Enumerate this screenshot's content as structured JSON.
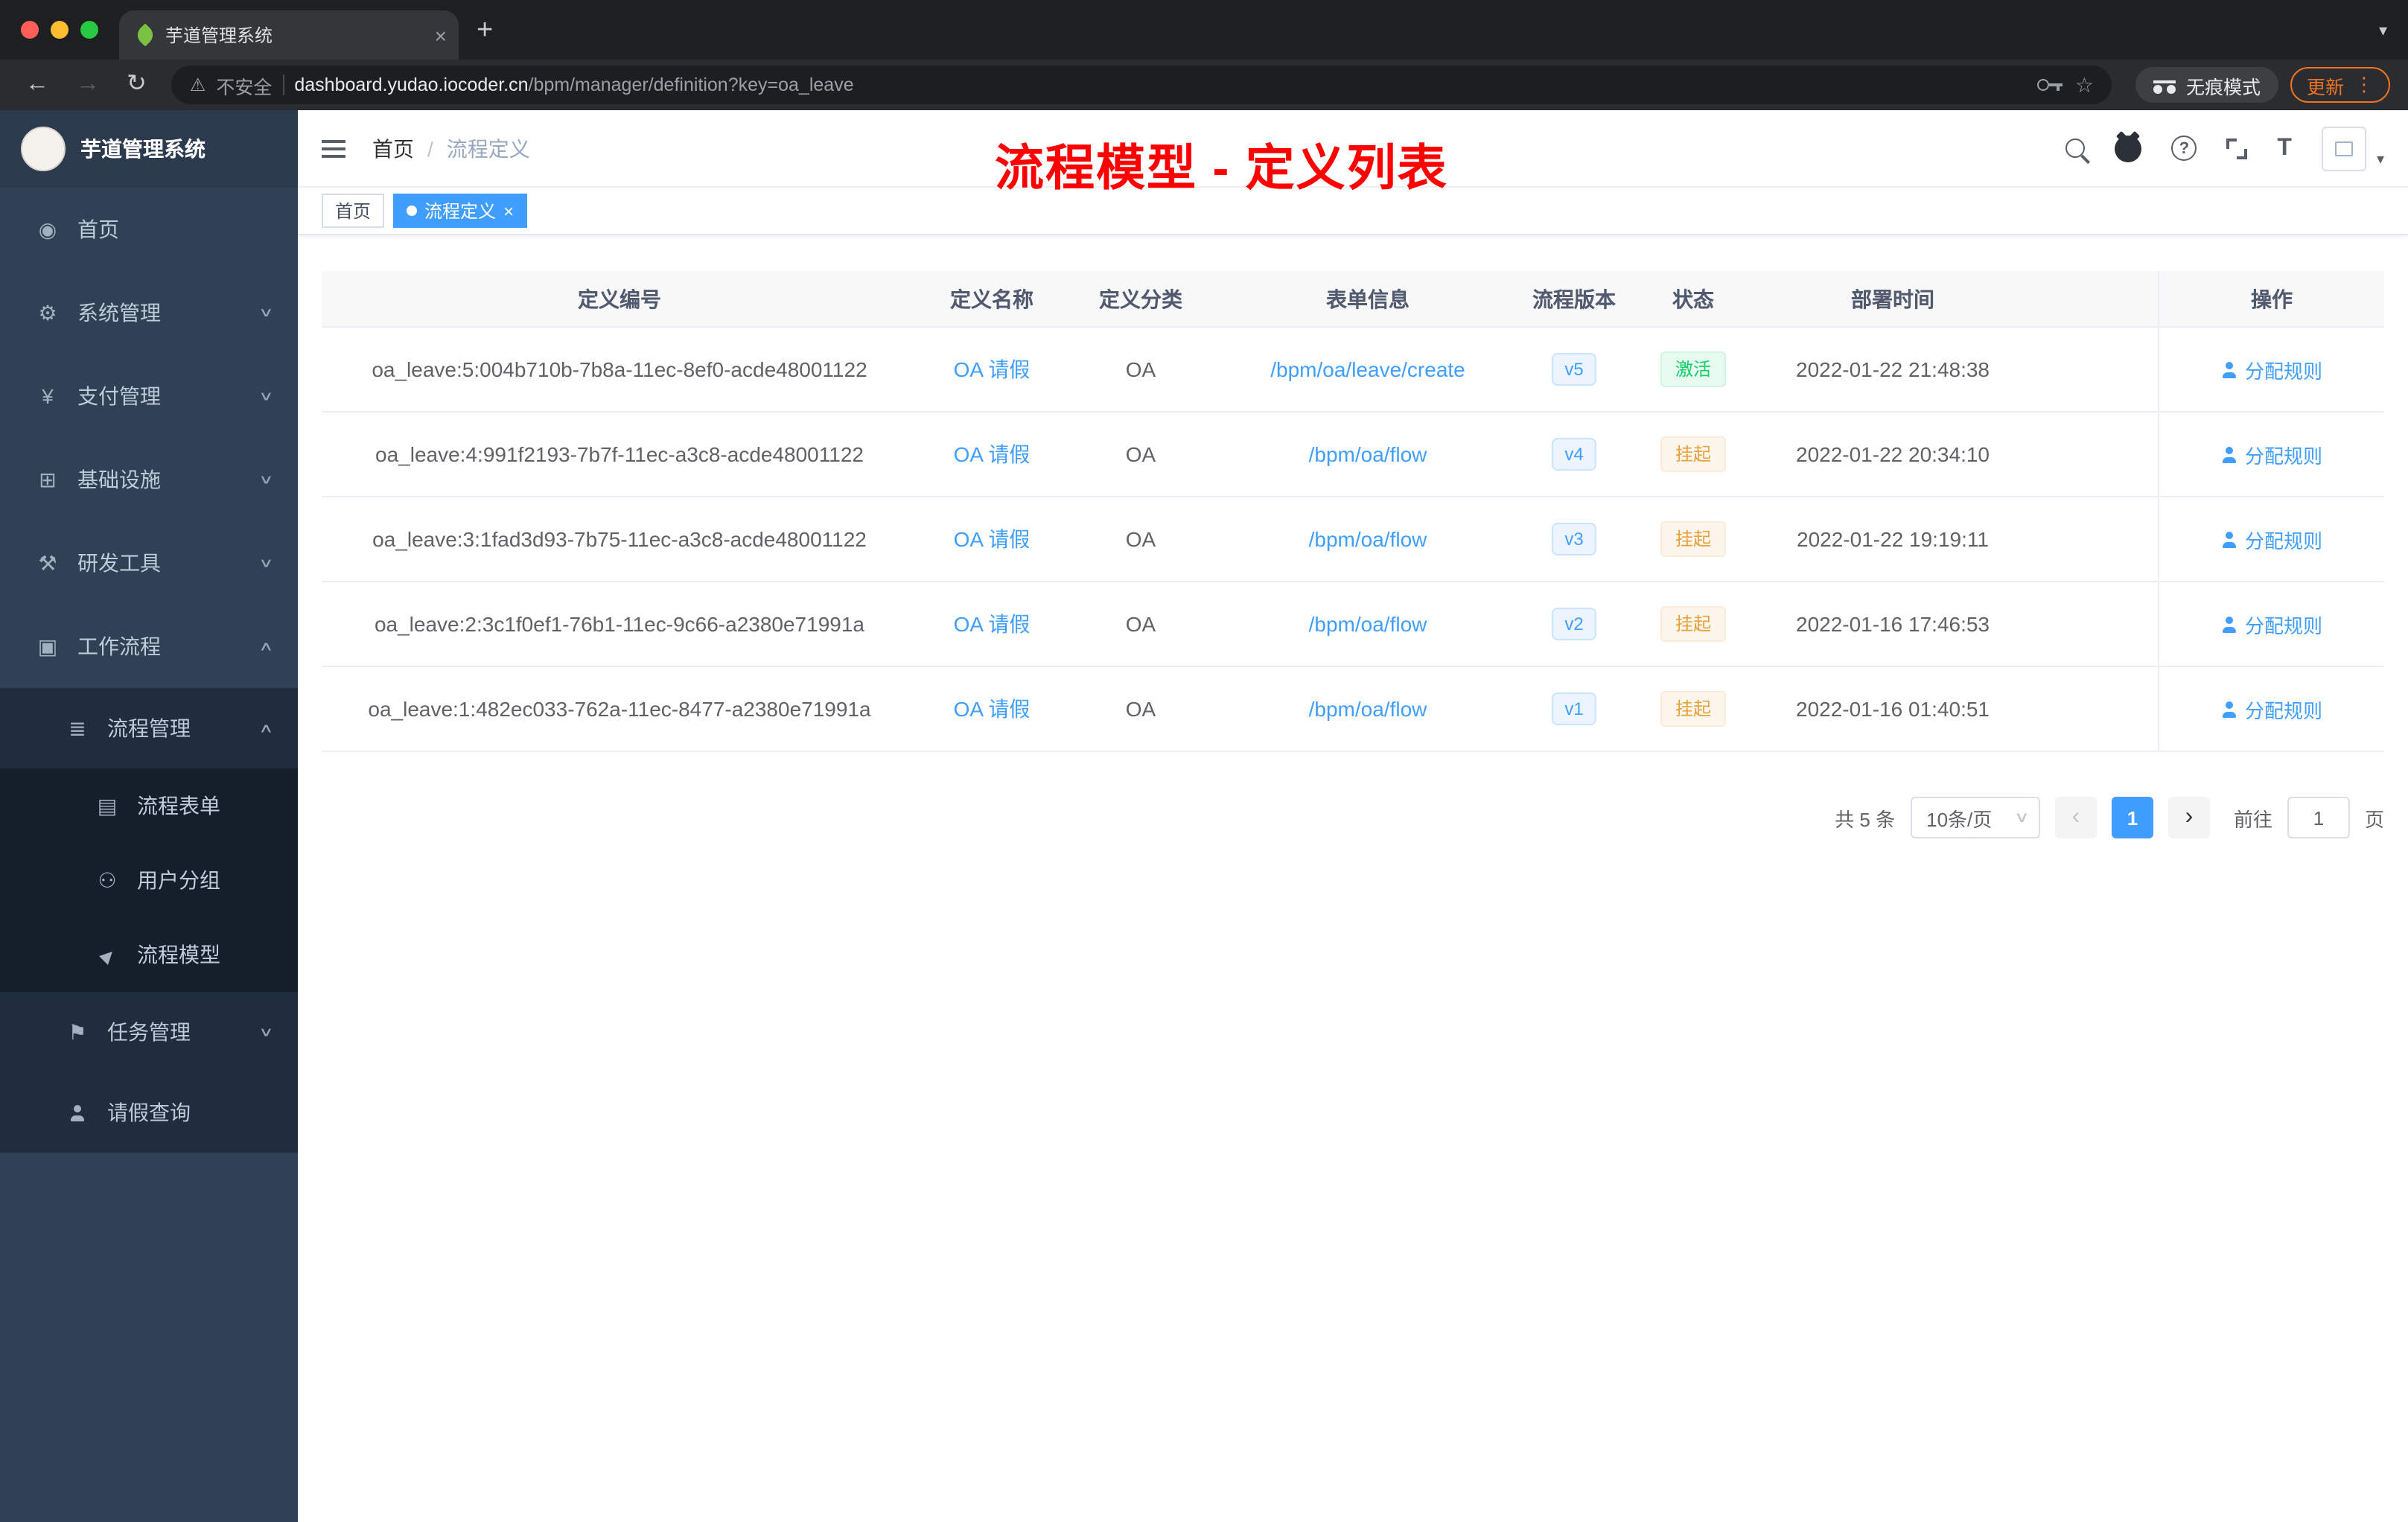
{
  "browser": {
    "tab_title": "芋道管理系统",
    "security_label": "不安全",
    "url_host": "dashboard.yudao.iocoder.cn",
    "url_path": "/bpm/manager/definition?key=oa_leave",
    "incognito_label": "无痕模式",
    "update_label": "更新"
  },
  "icons": {
    "close": "×",
    "plus": "+",
    "back": "←",
    "forward": "→",
    "reload": "↻",
    "warning": "⚠",
    "star": "☆",
    "menu_dots": "⋮",
    "caret_down": "▾",
    "chevron_down_small": "∨",
    "chevron_up_small": "∧",
    "question": "?",
    "font_size": "T",
    "breadcrumb_sep": "/",
    "prev": "‹",
    "next": "›"
  },
  "sidebar": {
    "logo_title": "芋道管理系统",
    "items": [
      {
        "label": "首页",
        "icon": "◉",
        "arrow": "",
        "level": 1
      },
      {
        "label": "系统管理",
        "icon": "⚙",
        "arrow": "∨",
        "level": 1
      },
      {
        "label": "支付管理",
        "icon": "¥",
        "arrow": "∨",
        "level": 1
      },
      {
        "label": "基础设施",
        "icon": "⊞",
        "arrow": "∨",
        "level": 1
      },
      {
        "label": "研发工具",
        "icon": "⚒",
        "arrow": "∨",
        "level": 1
      },
      {
        "label": "工作流程",
        "icon": "▣",
        "arrow": "∧",
        "level": 1
      },
      {
        "label": "流程管理",
        "icon": "≣",
        "arrow": "∧",
        "level": 2
      },
      {
        "label": "流程表单",
        "icon": "▤",
        "arrow": "",
        "level": 3
      },
      {
        "label": "用户分组",
        "icon": "⚇",
        "arrow": "",
        "level": 3
      },
      {
        "label": "流程模型",
        "icon": "▶",
        "arrow": "",
        "level": 3
      },
      {
        "label": "任务管理",
        "icon": "⚑",
        "arrow": "∨",
        "level": 2
      },
      {
        "label": "请假查询",
        "icon": "person",
        "arrow": "",
        "level": 2
      }
    ]
  },
  "header": {
    "breadcrumb_home": "首页",
    "breadcrumb_current": "流程定义",
    "overlay_title": "流程模型 - 定义列表"
  },
  "tags": {
    "home": "首页",
    "active": "流程定义"
  },
  "table": {
    "columns": [
      "定义编号",
      "定义名称",
      "定义分类",
      "表单信息",
      "流程版本",
      "状态",
      "部署时间",
      "操作"
    ],
    "rows": [
      {
        "id": "oa_leave:5:004b710b-7b8a-11ec-8ef0-acde48001122",
        "name": "OA 请假",
        "category": "OA",
        "form": "/bpm/oa/leave/create",
        "version": "v5",
        "status": "激活",
        "status_type": "success",
        "deployed_at": "2022-01-22 21:48:38",
        "action": "分配规则"
      },
      {
        "id": "oa_leave:4:991f2193-7b7f-11ec-a3c8-acde48001122",
        "name": "OA 请假",
        "category": "OA",
        "form": "/bpm/oa/flow",
        "version": "v4",
        "status": "挂起",
        "status_type": "warning",
        "deployed_at": "2022-01-22 20:34:10",
        "action": "分配规则"
      },
      {
        "id": "oa_leave:3:1fad3d93-7b75-11ec-a3c8-acde48001122",
        "name": "OA 请假",
        "category": "OA",
        "form": "/bpm/oa/flow",
        "version": "v3",
        "status": "挂起",
        "status_type": "warning",
        "deployed_at": "2022-01-22 19:19:11",
        "action": "分配规则"
      },
      {
        "id": "oa_leave:2:3c1f0ef1-76b1-11ec-9c66-a2380e71991a",
        "name": "OA 请假",
        "category": "OA",
        "form": "/bpm/oa/flow",
        "version": "v2",
        "status": "挂起",
        "status_type": "warning",
        "deployed_at": "2022-01-16 17:46:53",
        "action": "分配规则"
      },
      {
        "id": "oa_leave:1:482ec033-762a-11ec-8477-a2380e71991a",
        "name": "OA 请假",
        "category": "OA",
        "form": "/bpm/oa/flow",
        "version": "v1",
        "status": "挂起",
        "status_type": "warning",
        "deployed_at": "2022-01-16 01:40:51",
        "action": "分配规则"
      }
    ]
  },
  "pagination": {
    "total": "共 5 条",
    "page_size": "10条/页",
    "current_page": "1",
    "goto_label": "前往",
    "goto_value": "1",
    "page_unit": "页"
  }
}
